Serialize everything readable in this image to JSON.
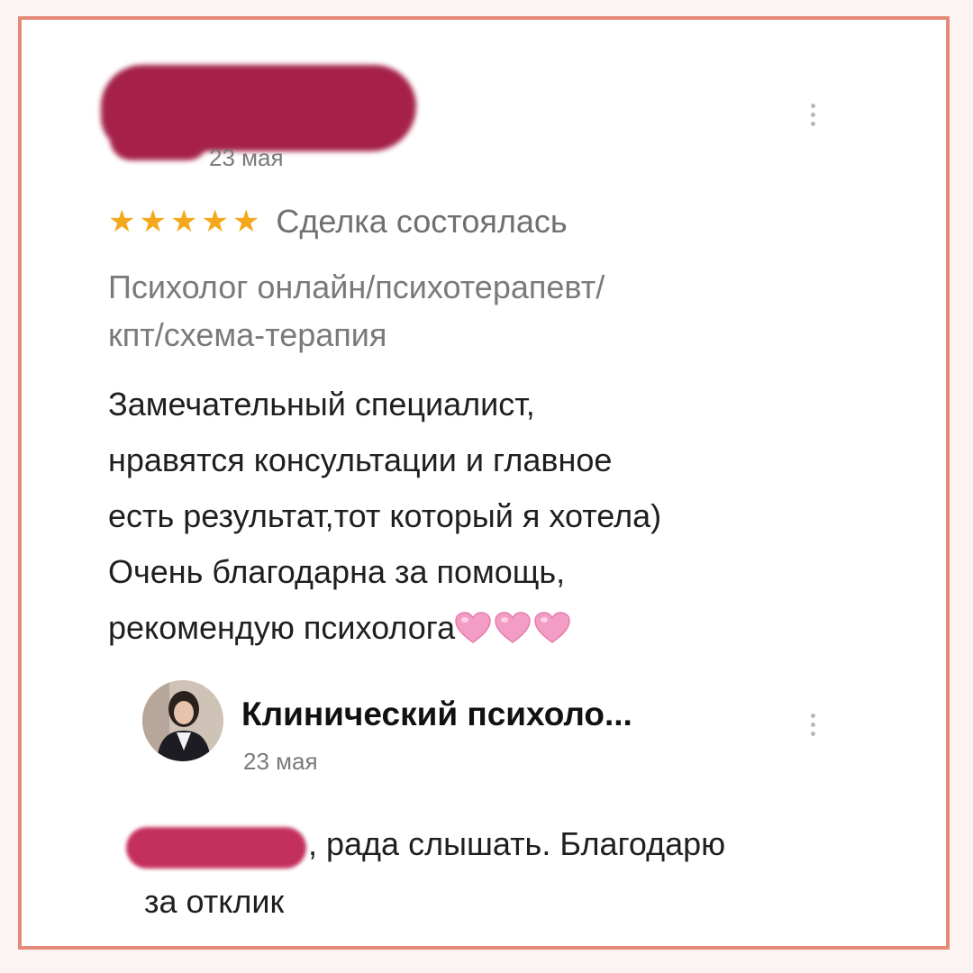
{
  "review": {
    "date": "23 мая",
    "rating": 5,
    "rating_max": 5,
    "deal_status": "Сделка состоялась",
    "service_title_lines": [
      "Психолог онлайн/психотерапевт/",
      "кпт/схема-терапия"
    ],
    "text_lines": [
      "Замечательный специалист,",
      "нравятся консультации и главное",
      "есть результат,тот который я хотела)",
      "Очень благодарна за помощь,",
      "рекомендую психолога"
    ],
    "emoji_count": 3,
    "colors": {
      "star": "#f3a91b",
      "redaction": "#a5214a",
      "heart": "#f39cc4",
      "frame": "#e58a78"
    }
  },
  "reply": {
    "author": "Клинический психоло...",
    "date": "23 мая",
    "text_lines": [
      ", рада слышать. Благодарю",
      "за отклик"
    ]
  },
  "icons": {
    "more": "more-vertical-icon",
    "star": "star-icon",
    "heart": "pink-heart-emoji"
  }
}
